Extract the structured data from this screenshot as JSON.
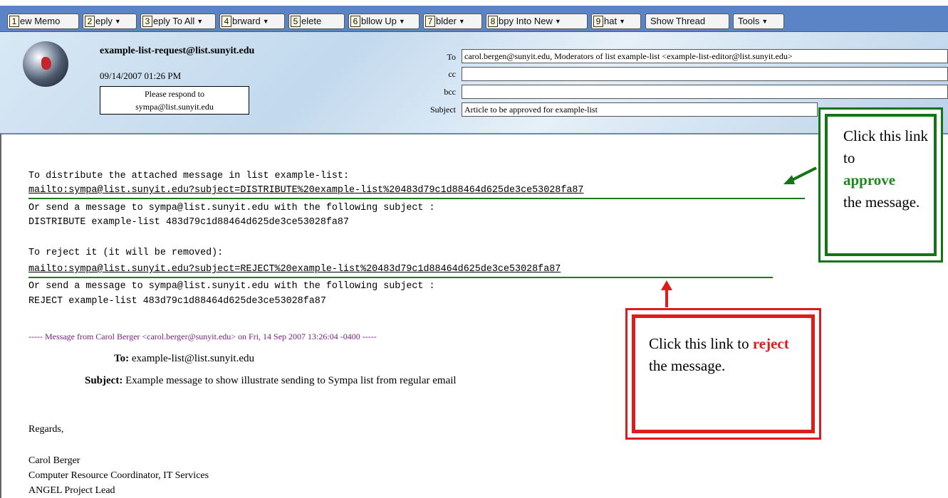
{
  "toolbar": {
    "buttons": [
      {
        "key": "1",
        "label": "ew Memo",
        "dropdown": false
      },
      {
        "key": "2",
        "label": "eply",
        "dropdown": true
      },
      {
        "key": "3",
        "label": "eply To All",
        "dropdown": true
      },
      {
        "key": "4",
        "label": "brward",
        "dropdown": true
      },
      {
        "key": "5",
        "label": "elete",
        "dropdown": false
      },
      {
        "key": "6",
        "label": "bllow Up",
        "dropdown": true
      },
      {
        "key": "7",
        "label": "blder",
        "dropdown": true
      },
      {
        "key": "8",
        "label": "bpy Into New",
        "dropdown": true
      },
      {
        "key": "9",
        "label": "hat",
        "dropdown": true
      }
    ],
    "show_thread": "Show Thread",
    "tools": "Tools"
  },
  "header": {
    "from": "example-list-request@list.sunyit.edu",
    "datetime": "09/14/2007 01:26 PM",
    "respond_line1": "Please respond to",
    "respond_line2": "sympa@list.sunyit.edu",
    "to_label": "To",
    "to_value": "carol.bergen@sunyit.edu, Moderators of list example-list <example-list-editor@list.sunyit.edu>",
    "cc_label": "cc",
    "cc_value": "",
    "bcc_label": "bcc",
    "bcc_value": "",
    "subject_label": "Subject",
    "subject_value": "Article to be approved for example-list"
  },
  "body": {
    "distribute_intro": "To distribute the attached message in list example-list:",
    "distribute_link": "mailto:sympa@list.sunyit.edu?subject=DISTRIBUTE%20example-list%20483d79c1d88464d625de3ce53028fa87",
    "distribute_alt": "Or send a message to sympa@list.sunyit.edu with the following subject :",
    "distribute_subject": "DISTRIBUTE example-list 483d79c1d88464d625de3ce53028fa87",
    "reject_intro": "To reject it (it will be removed):",
    "reject_link": "mailto:sympa@list.sunyit.edu?subject=REJECT%20example-list%20483d79c1d88464d625de3ce53028fa87",
    "reject_alt": "Or send a message to sympa@list.sunyit.edu with the following subject :",
    "reject_subject": "REJECT example-list 483d79c1d88464d625de3ce53028fa87",
    "forward_line": "----- Message from Carol Berger <carol.berger@sunyit.edu> on Fri, 14 Sep 2007 13:26:04 -0400 -----",
    "fwd_to_label": "To:",
    "fwd_to_value": "example-list@list.sunyit.edu",
    "fwd_subject_label": "Subject:",
    "fwd_subject_value": "Example message to show illustrate sending to Sympa list from regular email",
    "regards": "Regards,",
    "sig_name": "Carol Berger",
    "sig_title": "Computer Resource Coordinator, IT Services",
    "sig_role": "ANGEL Project Lead"
  },
  "callouts": {
    "approve_pre": "Click this link to",
    "approve_word": "approve",
    "approve_post": "the message.",
    "reject_pre": "Click this link to",
    "reject_word": "reject",
    "reject_post": "the message."
  },
  "colors": {
    "toolbar": "#5b84c6",
    "approve": "#137513",
    "reject": "#dd1c1c",
    "forward_line": "#7a1f80"
  }
}
